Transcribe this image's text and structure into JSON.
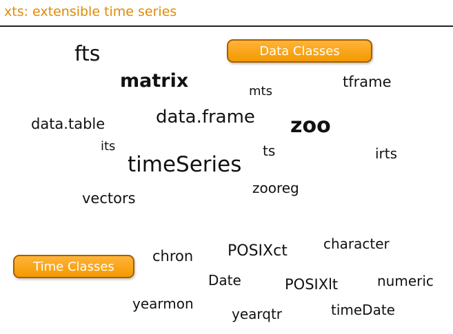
{
  "slide": {
    "title": "xts: extensible time series"
  },
  "data_classes_label": "Data Classes",
  "time_classes_label": "Time Classes",
  "data_words": {
    "fts": "fts",
    "matrix": "matrix",
    "mts": "mts",
    "tframe": "tframe",
    "data_table": "data.table",
    "data_frame": "data.frame",
    "zoo": "zoo",
    "its": "its",
    "ts": "ts",
    "irts": "irts",
    "timeSeries": "timeSeries",
    "zooreg": "zooreg",
    "vectors": "vectors"
  },
  "time_words": {
    "chron": "chron",
    "POSIXct": "POSIXct",
    "character": "character",
    "Date": "Date",
    "POSIXlt": "POSIXlt",
    "numeric": "numeric",
    "yearmon": "yearmon",
    "yearqtr": "yearqtr",
    "timeDate": "timeDate"
  }
}
